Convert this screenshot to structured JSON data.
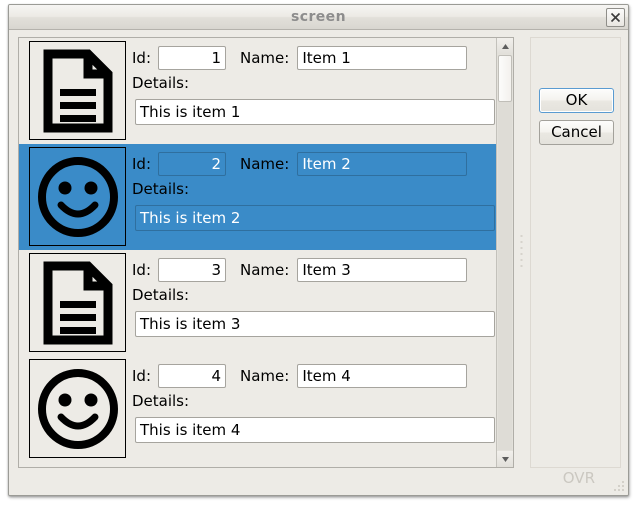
{
  "window": {
    "title": "screen",
    "close_icon": "close-x-icon"
  },
  "buttons": {
    "ok_label": "OK",
    "cancel_label": "Cancel"
  },
  "labels": {
    "id": "Id:",
    "name": "Name:",
    "details": "Details:"
  },
  "status": {
    "overwrite_mode": "OVR"
  },
  "scrollbar": {
    "up_arrow_icon": "triangle-up-icon",
    "down_arrow_icon": "triangle-down-icon"
  },
  "colors": {
    "selection": "#3a8bc8",
    "window_background": "#edebe6",
    "field_background": "#ffffff",
    "focus_border": "#5a9bd1",
    "status_text": "#cbc8c1"
  },
  "list": {
    "items": [
      {
        "icon": "document-icon",
        "id": "1",
        "name": "Item 1",
        "details": "This is item 1",
        "selected": false
      },
      {
        "icon": "smiley-face-icon",
        "id": "2",
        "name": "Item 2",
        "details": "This is item 2",
        "selected": true
      },
      {
        "icon": "document-icon",
        "id": "3",
        "name": "Item 3",
        "details": "This is item 3",
        "selected": false
      },
      {
        "icon": "smiley-face-icon",
        "id": "4",
        "name": "Item 4",
        "details": "This is item 4",
        "selected": false
      }
    ]
  }
}
